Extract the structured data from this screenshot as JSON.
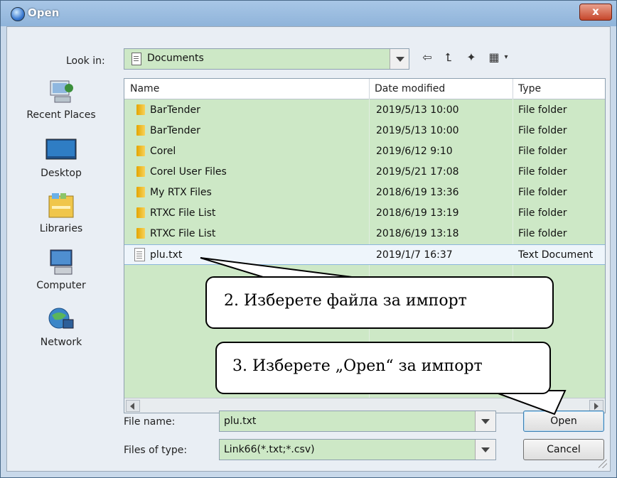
{
  "dialog": {
    "title": "Open",
    "close_label": "x"
  },
  "lookin": {
    "label": "Look in:",
    "value": "Documents"
  },
  "toolbar": {
    "back_icon": "back-arrow-icon",
    "up_icon": "up-folder-icon",
    "new_icon": "new-folder-icon",
    "view_icon": "view-menu-icon"
  },
  "places": [
    {
      "label": "Recent Places",
      "icon": "recent-places-icon"
    },
    {
      "label": "Desktop",
      "icon": "desktop-icon"
    },
    {
      "label": "Libraries",
      "icon": "libraries-icon"
    },
    {
      "label": "Computer",
      "icon": "computer-icon"
    },
    {
      "label": "Network",
      "icon": "network-icon"
    }
  ],
  "columns": {
    "name": "Name",
    "date": "Date modified",
    "type": "Type"
  },
  "files": [
    {
      "name": "BarTender",
      "date": "2019/5/13 10:00",
      "type": "File folder",
      "kind": "folder"
    },
    {
      "name": "BarTender",
      "date": "2019/5/13 10:00",
      "type": "File folder",
      "kind": "folder"
    },
    {
      "name": "Corel",
      "date": "2019/6/12 9:10",
      "type": "File folder",
      "kind": "folder"
    },
    {
      "name": "Corel User Files",
      "date": "2019/5/21 17:08",
      "type": "File folder",
      "kind": "folder"
    },
    {
      "name": "My RTX Files",
      "date": "2018/6/19 13:36",
      "type": "File folder",
      "kind": "folder"
    },
    {
      "name": "RTXC File List",
      "date": "2018/6/19 13:19",
      "type": "File folder",
      "kind": "folder"
    },
    {
      "name": "RTXC File List",
      "date": "2018/6/19 13:18",
      "type": "File folder",
      "kind": "folder"
    },
    {
      "name": "plu.txt",
      "date": "2019/1/7 16:37",
      "type": "Text Document",
      "kind": "text",
      "selected": true
    }
  ],
  "filename": {
    "label": "File name:",
    "value": "plu.txt"
  },
  "filetype": {
    "label": "Files of type:",
    "value": "Link66(*.txt;*.csv)"
  },
  "buttons": {
    "open": "Open",
    "cancel": "Cancel"
  },
  "callouts": {
    "select_file": "2. Изберете файла за импорт",
    "press_open": "3. Изберете „Open“ за импорт"
  }
}
